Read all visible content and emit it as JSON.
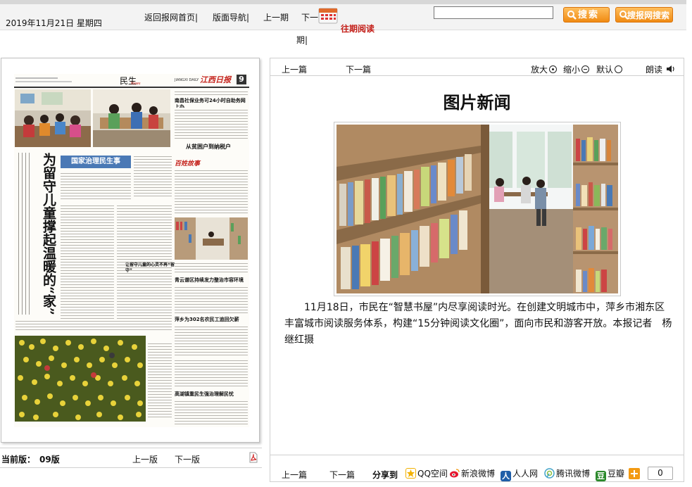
{
  "header": {
    "date": "2019年11月21日 星期四",
    "nav": {
      "home": "返回报网首页",
      "layout_nav": "版面导航",
      "prev_issue": "上一期",
      "next_issue_a": "下一",
      "next_issue_b": "期",
      "past_reading": "往期阅读"
    },
    "search": {
      "input_value": "",
      "button": "搜索",
      "site_button": "搜报网搜索"
    }
  },
  "newspaper": {
    "section": "民生",
    "section_en": "News",
    "masthead_en": "JIANGXI DAILY",
    "page_number": "9",
    "headline_vertical": "为留守儿童撑起温暖的“家”",
    "column_banner": "国家治理民生事",
    "sub_headline_1": "南昌社保业务可24小时自助务网上办",
    "sub_headline_2": "从贫困户到纳税户",
    "sub_headline_3": "青云谱区持续发力整治市容环境",
    "sub_headline_4": "萍乡为302名农民工追回欠薪",
    "sub_headline_5": "高湖镇重民生强治理解民忧",
    "current_version_label": "当前版：",
    "current_version": "09版",
    "prev_version": "上一版",
    "next_version": "下一版"
  },
  "article": {
    "toolbar": {
      "prev": "上一篇",
      "next": "下一篇",
      "zoom_in": "放大",
      "zoom_out": "缩小",
      "default": "默认",
      "read_aloud": "朗读"
    },
    "title": "图片新闻",
    "caption": "11月18日，市民在“智慧书屋”内尽享阅读时光。在创建文明城市中，萍乡市湘东区丰富城市阅读服务体系，构建“15分钟阅读文化圈”，面向市民和游客开放。本报记者　杨继红摄",
    "footer": {
      "prev": "上一篇",
      "next": "下一篇",
      "share_label": "分享到",
      "share_targets": [
        "QQ空间",
        "新浪微博",
        "人人网",
        "腾讯微博",
        "豆瓣"
      ],
      "share_count": "0"
    }
  },
  "colors": {
    "accent_red": "#c4201a",
    "button_orange": "#f08a12",
    "frame_gray": "#bfbfbf"
  }
}
